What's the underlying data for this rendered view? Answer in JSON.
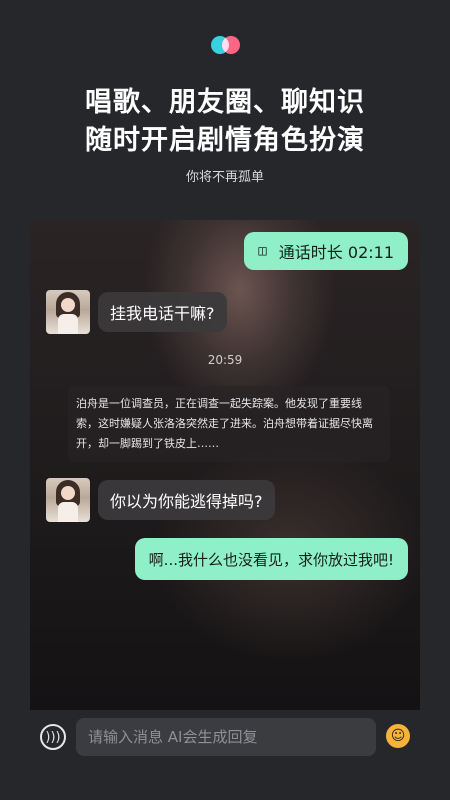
{
  "headline": {
    "line1": "唱歌、朋友圈、聊知识",
    "line2": "随时开启剧情角色扮演",
    "subtitle": "你将不再孤单"
  },
  "chat": {
    "call_label": "通话时长 02:11",
    "msg1": "挂我电话干嘛?",
    "timestamp": "20:59",
    "narration": "泊舟是一位调查员，正在调查一起失踪案。他发现了重要线索，这时嫌疑人张洛洛突然走了进来。泊舟想带着证据尽快离开，却一脚踢到了铁皮上……",
    "msg2": "你以为你能逃得掉吗?",
    "reply": "啊...我什么也没看见，求你放过我吧!"
  },
  "input": {
    "placeholder": "请输入消息 AI会生成回复"
  },
  "colors": {
    "accent_bubble": "#8ff0c8",
    "logo_cyan": "#3ad0e0",
    "logo_pink": "#ff4a6e"
  }
}
